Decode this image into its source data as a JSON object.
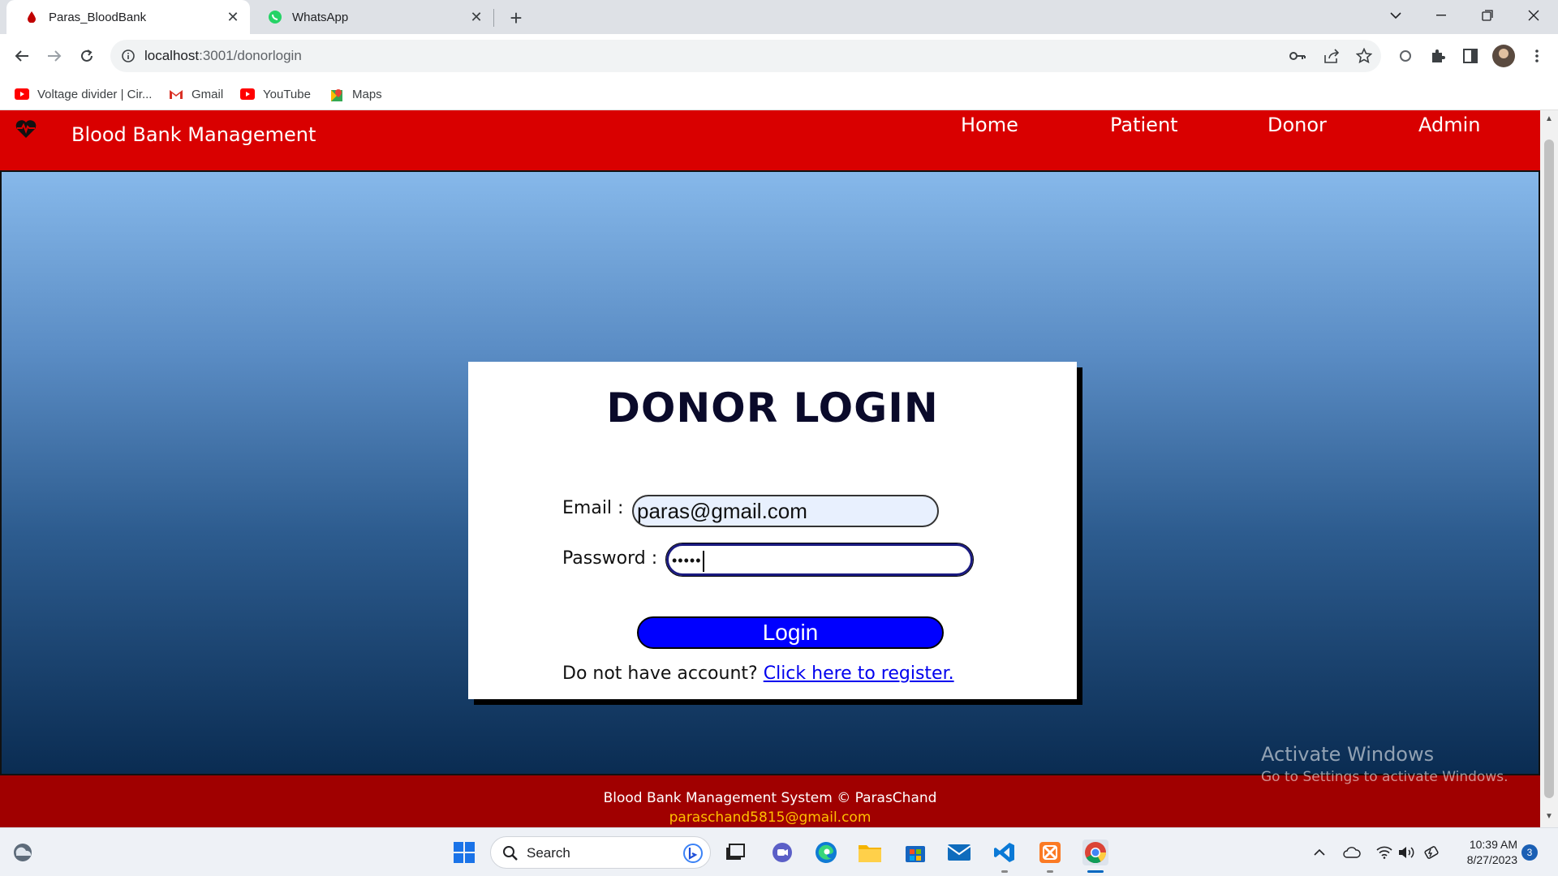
{
  "browser": {
    "tabs": [
      {
        "title": "Paras_BloodBank",
        "active": true
      },
      {
        "title": "WhatsApp",
        "active": false
      }
    ],
    "url_host": "localhost",
    "url_path": ":3001/donorlogin",
    "bookmarks": [
      {
        "label": "Voltage divider | Cir...",
        "icon": "youtube-icon"
      },
      {
        "label": "Gmail",
        "icon": "gmail-icon"
      },
      {
        "label": "YouTube",
        "icon": "youtube-icon"
      },
      {
        "label": "Maps",
        "icon": "maps-icon"
      }
    ]
  },
  "navbar": {
    "brand": "Blood Bank Management",
    "links": [
      "Home",
      "Patient",
      "Donor",
      "Admin"
    ]
  },
  "login": {
    "title": "DONOR LOGIN",
    "email_label": "Email :",
    "email_value": "paras@gmail.com",
    "password_label": "Password :",
    "password_value": "•••••",
    "button": "Login",
    "register_prompt": "Do not have account?",
    "register_link": "Click here to register."
  },
  "footer": {
    "line1": "Blood Bank Management System © ParasChand",
    "line2": "paraschand5815@gmail.com"
  },
  "watermark": {
    "line1": "Activate Windows",
    "line2": "Go to Settings to activate Windows."
  },
  "taskbar": {
    "search_label": "Search",
    "time": "10:39 AM",
    "date": "8/27/2023",
    "notification_count": "3"
  },
  "colors": {
    "navbar": "#d90000",
    "footer": "#a00000",
    "login_button": "#0000ff",
    "footer_email": "#ffc000"
  }
}
